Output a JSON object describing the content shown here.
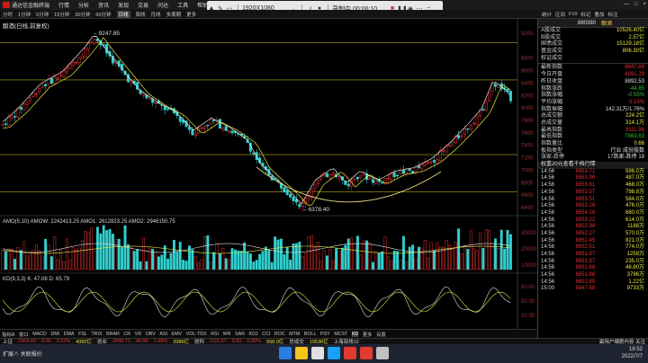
{
  "app_titlebar": {
    "title": "通达信金融终端",
    "menus": [
      "行情",
      "分析",
      "资讯",
      "发现",
      "交易",
      "问达",
      "工具",
      "帮助"
    ],
    "right": [
      "—",
      "□",
      "×"
    ]
  },
  "recording_bar": {
    "resolution": "1920X1080",
    "status": "录制中 00:06:10"
  },
  "toolbar": {
    "items": [
      "分时",
      "1分钟",
      "5分钟",
      "15分钟",
      "30分钟",
      "60分钟",
      "日线",
      "周线",
      "月线",
      "多周期",
      "更多"
    ],
    "active_index": 6
  },
  "right_toolbar": {
    "items": [
      "统计",
      "区间",
      "F10",
      "标记",
      "叠加",
      "标注"
    ]
  },
  "chart": {
    "title": "酿酒(日线,前复权)",
    "high_label": "9247.85",
    "low_label": "6378.40",
    "y_axis_labels": [
      "9200",
      "8800",
      "8600",
      "8400",
      "8200",
      "8000",
      "7800",
      "7600",
      "7400",
      "7200",
      "7000",
      "6800",
      "6600",
      "6400"
    ],
    "amo_title": "AMO(5,10) AMOW: 2242413.25 AMO1: 2612823.25 AMO2: 2946150.75",
    "amo_axis": [
      "30000",
      "20000",
      "10000"
    ],
    "kdj_title": "KD(9,3,3) K: 47.08 D: 65.79",
    "kdj_axis": [
      "80.00",
      "50.00",
      "20.00"
    ],
    "indicator_tabs": [
      "指标A",
      "窗口",
      "MACD",
      "DMI",
      "DMA",
      "FSL",
      "TRIX",
      "BRAR",
      "CR",
      "VR",
      "OBV",
      "ASI",
      "EMV",
      "VOL-TDX",
      "RSI",
      "WR",
      "SAR",
      "KDJ",
      "CCI",
      "ROC",
      "MTM",
      "BOLL",
      "PSY",
      "MCST",
      "KD",
      "更多",
      "设置"
    ],
    "bottom_left": "扩展 ∧ 关联报价"
  },
  "right_panel": {
    "code": "880380",
    "name": "酿酒",
    "stats": [
      {
        "label": "A股成交",
        "value": "10526.40亿",
        "color": "yel"
      },
      {
        "label": "B股成交",
        "value": "2.57亿",
        "color": "yel"
      },
      {
        "label": "国债成交",
        "value": "15129.18亿",
        "color": "yel"
      },
      {
        "label": "基金成交",
        "value": "806.30亿",
        "color": "yel"
      },
      {
        "label": "权证成交",
        "value": "",
        "color": "yel"
      }
    ],
    "quote": [
      {
        "label": "最新指数",
        "value": "8847.68",
        "color": "red"
      },
      {
        "label": "今日开盘",
        "value": "8891.29",
        "color": "red"
      },
      {
        "label": "昨日收盘",
        "value": "8892.53",
        "color": "wht"
      },
      {
        "label": "指数涨跌",
        "value": "-44.85",
        "color": "grn"
      },
      {
        "label": "指数涨幅",
        "value": "-0.55%",
        "color": "grn"
      },
      {
        "label": "平均涨幅",
        "value": "0.13%",
        "color": "red"
      },
      {
        "label": "指数振幅",
        "value": "142.31万/1.76%",
        "color": "wht"
      },
      {
        "label": "总成交额",
        "value": "224.2亿",
        "color": "yel"
      },
      {
        "label": "总成交量",
        "value": "314.1万",
        "color": "yel"
      },
      {
        "label": "最高指数",
        "value": "8111.96",
        "color": "red"
      },
      {
        "label": "最低指数",
        "value": "7863.63",
        "color": "grn"
      },
      {
        "label": "指数量比",
        "value": "0.66",
        "color": "yel"
      },
      {
        "label": "板指类型",
        "value": "行业 成份股数",
        "color": "wht"
      },
      {
        "label": "涨家-跌停",
        "value": "17跌家-跌停 19",
        "color": "wht"
      }
    ],
    "tick_header": "权重20元查看千档行情",
    "ticks": [
      {
        "t": "14:56",
        "p": "8853.71",
        "v": "596.0万"
      },
      {
        "t": "14:56",
        "p": "8853.96",
        "v": "487.0万"
      },
      {
        "t": "14:56",
        "p": "8853.61",
        "v": "468.0万"
      },
      {
        "t": "14:56",
        "p": "8853.57",
        "v": "798.8万"
      },
      {
        "t": "14:56",
        "p": "8853.51",
        "v": "584.0万"
      },
      {
        "t": "14:56",
        "p": "8853.26",
        "v": "476.0万"
      },
      {
        "t": "14:56",
        "p": "8854.18",
        "v": "680.0万"
      },
      {
        "t": "14:56",
        "p": "8853.22",
        "v": "614.0万"
      },
      {
        "t": "14:56",
        "p": "8852.94",
        "v": "1188万"
      },
      {
        "t": "14:56",
        "p": "8852.27",
        "v": "570.0万"
      },
      {
        "t": "14:56",
        "p": "8852.45",
        "v": "821.0万"
      },
      {
        "t": "14:56",
        "p": "8852.51",
        "v": "774.0万"
      },
      {
        "t": "14:56",
        "p": "8851.97",
        "v": "1259万"
      },
      {
        "t": "14:56",
        "p": "8851.97",
        "v": "235.0万"
      },
      {
        "t": "14:56",
        "p": "8851.88",
        "v": "48.80万"
      },
      {
        "t": "14:56",
        "p": "8851.88",
        "v": "3786万"
      },
      {
        "t": "14:56",
        "p": "8853.85",
        "v": "1.22亿"
      },
      {
        "t": "15:00",
        "p": "8847.68",
        "v": "9733万"
      }
    ]
  },
  "status_bar": {
    "items": [
      {
        "text": "上证",
        "color": "#ddd"
      },
      {
        "text": "3364.40",
        "color": "#e03030"
      },
      {
        "text": "9.05",
        "color": "#e03030"
      },
      {
        "text": "0.27%",
        "color": "#e03030"
      },
      {
        "text": "4382亿",
        "color": "#e8e840"
      },
      {
        "text": "创业",
        "color": "#ddd"
      },
      {
        "text": "2849.71",
        "color": "#e03030"
      },
      {
        "text": "46.99",
        "color": "#e03030"
      },
      {
        "text": "1.68%",
        "color": "#e03030"
      },
      {
        "text": "2086亿",
        "color": "#e8e840"
      },
      {
        "text": "创科",
        "color": "#ddd"
      },
      {
        "text": "1111.67",
        "color": "#e03030"
      },
      {
        "text": "9.92",
        "color": "#e03030"
      },
      {
        "text": "0.90%",
        "color": "#e03030"
      },
      {
        "text": "558.0亿",
        "color": "#e8e840"
      },
      {
        "text": "总成交",
        "color": "#ddd"
      },
      {
        "text": "10530亿",
        "color": "#e8e840"
      },
      {
        "text": "上海双线12",
        "color": "#ddd"
      }
    ],
    "right": "副用户编剧内容 关注"
  },
  "taskbar": {
    "left_text": "扩展∧ 关联报价",
    "time": "18:52",
    "date": "2022/7/7",
    "icon_colors": [
      "#2a7de1",
      "#f5c518",
      "#e0e0e0",
      "#18a0fb",
      "#e23b2e",
      "#e23b2e",
      "#c0c0c0"
    ]
  }
}
